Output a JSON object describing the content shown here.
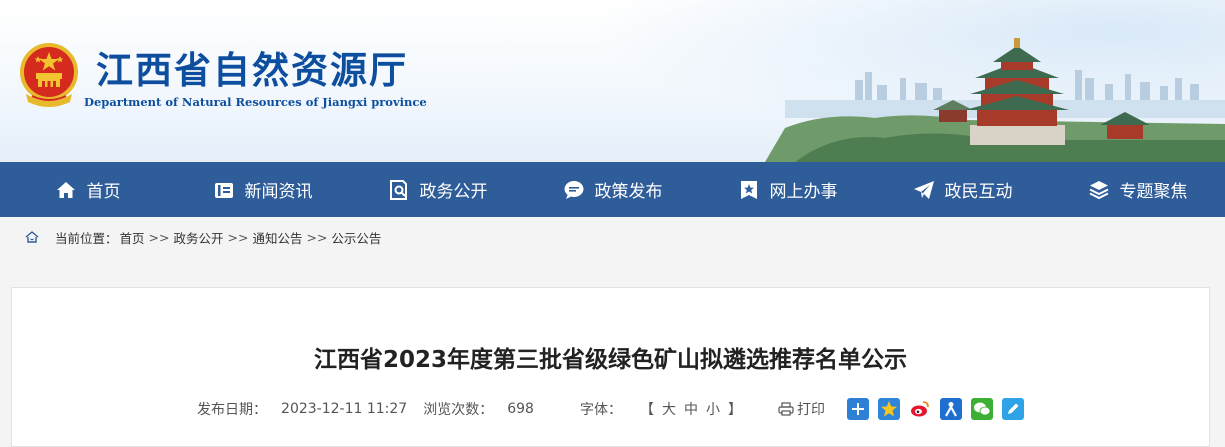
{
  "header": {
    "title": "江西省自然资源厅",
    "subtitle": "Department of Natural Resources of Jiangxi province"
  },
  "nav": [
    {
      "label": "首页",
      "icon": "home-icon"
    },
    {
      "label": "新闻资讯",
      "icon": "news-icon"
    },
    {
      "label": "政务公开",
      "icon": "document-search-icon"
    },
    {
      "label": "政策发布",
      "icon": "chat-bubble-icon"
    },
    {
      "label": "网上办事",
      "icon": "star-service-icon"
    },
    {
      "label": "政民互动",
      "icon": "paper-plane-icon"
    },
    {
      "label": "专题聚焦",
      "icon": "layers-icon"
    }
  ],
  "breadcrumb": {
    "label": "当前位置：",
    "items": [
      "首页",
      "政务公开",
      "通知公告",
      "公示公告"
    ],
    "separator": ">>"
  },
  "article": {
    "title": "江西省2023年度第三批省级绿色矿山拟遴选推荐名单公示",
    "date_label": "发布日期：",
    "date": "2023-12-11 11:27",
    "views_label": "浏览次数：",
    "views": "698",
    "font_label": "字体：",
    "font_open": "【",
    "font_large": "大",
    "font_medium": "中",
    "font_small": "小",
    "font_close": "】",
    "print_label": "打印",
    "share_icons": [
      "share-plus-icon",
      "qzone-icon",
      "weibo-icon",
      "renren-icon",
      "wechat-icon",
      "pen-icon"
    ]
  },
  "colors": {
    "nav_bg": "#2f5d9a",
    "title_blue": "#0d4f9e"
  }
}
